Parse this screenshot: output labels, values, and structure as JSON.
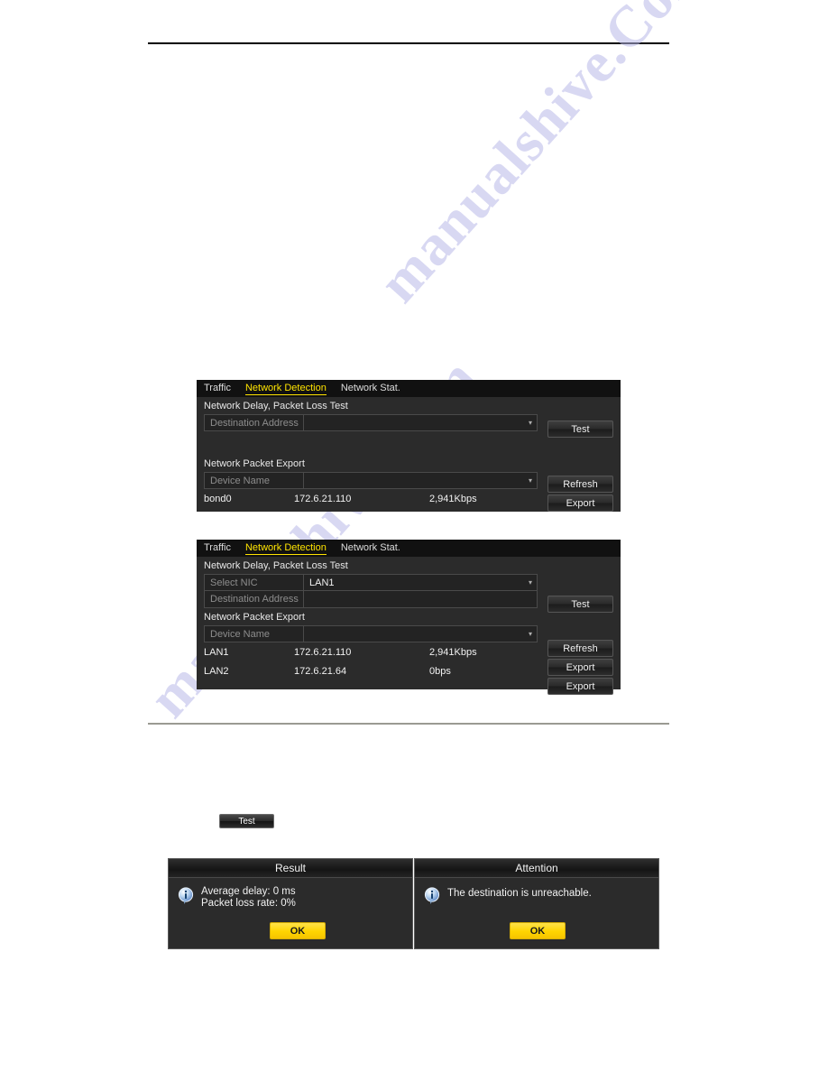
{
  "watermark": {
    "text_a": "manualshive.Com",
    "text_b": "manualshive.Com",
    "color": "#b9b9e8"
  },
  "theme": {
    "panel_bg": "#2b2b2b",
    "tabbar_bg": "#111111",
    "active_tab_color": "#ffe400",
    "ok_button_color": "#ffd400",
    "text_color": "#e8e8e8",
    "placeholder_color": "#8d8d8d"
  },
  "standalone_test_button": {
    "label": "Test"
  },
  "panel_1": {
    "tabs": [
      {
        "label": "Traffic",
        "active": false
      },
      {
        "label": "Network Detection",
        "active": true
      },
      {
        "label": "Network Stat.",
        "active": false
      }
    ],
    "section_delay": {
      "title": "Network Delay, Packet Loss Test"
    },
    "destination": {
      "label": "Destination Address",
      "value": ""
    },
    "test_button": {
      "label": "Test"
    },
    "section_export": {
      "title": "Network Packet Export"
    },
    "device": {
      "label": "Device Name",
      "value": ""
    },
    "refresh_button": {
      "label": "Refresh"
    },
    "export_buttons": [
      {
        "label": "Export"
      }
    ],
    "table": {
      "rows": [
        {
          "name": "bond0",
          "address": "172.6.21.110",
          "rate": "2,941Kbps"
        }
      ]
    }
  },
  "panel_2": {
    "tabs": [
      {
        "label": "Traffic",
        "active": false
      },
      {
        "label": "Network Detection",
        "active": true
      },
      {
        "label": "Network Stat.",
        "active": false
      }
    ],
    "section_delay": {
      "title": "Network Delay, Packet Loss Test"
    },
    "select_nic": {
      "label": "Select NIC",
      "value": "LAN1"
    },
    "destination": {
      "label": "Destination Address",
      "value": ""
    },
    "test_button": {
      "label": "Test"
    },
    "section_export": {
      "title": "Network Packet Export"
    },
    "device": {
      "label": "Device Name",
      "value": ""
    },
    "refresh_button": {
      "label": "Refresh"
    },
    "export_buttons": [
      {
        "label": "Export"
      },
      {
        "label": "Export"
      }
    ],
    "table": {
      "rows": [
        {
          "name": "LAN1",
          "address": "172.6.21.110",
          "rate": "2,941Kbps"
        },
        {
          "name": "LAN2",
          "address": "172.6.21.64",
          "rate": "0bps"
        }
      ]
    }
  },
  "dialog_result": {
    "title": "Result",
    "message": "Average delay: 0 ms\nPacket loss rate: 0%",
    "ok_label": "OK",
    "icon": "info-icon"
  },
  "dialog_attention": {
    "title": "Attention",
    "message": "The destination is unreachable.",
    "ok_label": "OK",
    "icon": "info-icon"
  }
}
